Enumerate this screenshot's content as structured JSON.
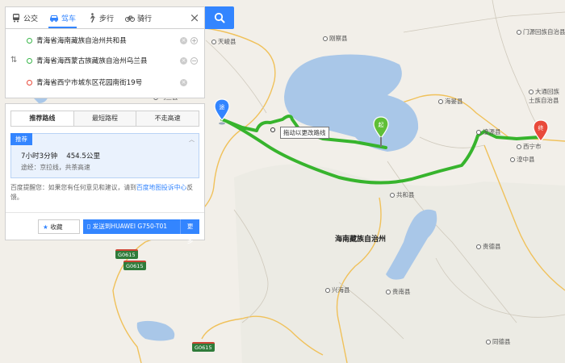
{
  "tabs": [
    {
      "label": "公交",
      "icon": "bus-icon"
    },
    {
      "label": "驾车",
      "icon": "car-icon",
      "active": true
    },
    {
      "label": "步行",
      "icon": "walk-icon"
    },
    {
      "label": "骑行",
      "icon": "bike-icon"
    }
  ],
  "close_label": "×",
  "inputs": [
    {
      "value": "青海省海南藏族自治州共和县",
      "role": "start"
    },
    {
      "value": "青海省海西蒙古族藏族自治州乌兰县",
      "role": "via"
    },
    {
      "value": "青海省西宁市城东区花园南街19号",
      "role": "end"
    }
  ],
  "swap_label": "⇅",
  "route_tabs": [
    "推荐路线",
    "最短路程",
    "不走高速"
  ],
  "plan": {
    "badge": "推荐",
    "time": "7小时3分钟",
    "distance": "454.5公里",
    "via": "途经：京拉线，共茶高速"
  },
  "tip": {
    "before": "百度提醒您：如果您有任何意见和建议，请到",
    "link": "百度地图投诉中心",
    "after": "反馈。"
  },
  "actions": {
    "favorite": "收藏",
    "send": "发送到HUAWEI G750-T01",
    "more": "更多"
  },
  "map": {
    "drag_tip": "拖动以更改路线",
    "markers": {
      "start": "起",
      "end": "终",
      "via": "途"
    },
    "labels": [
      "门源回族自治县",
      "刚察县",
      "天峻县",
      "海晏县",
      "湟源县",
      "湟中县",
      "大通回族土族自治县",
      "乌兰县",
      "共和县",
      "海南藏族自治州",
      "贵德县",
      "兴海县",
      "贵南县",
      "同德县",
      "西宁市"
    ],
    "shields": [
      "G0615",
      "G0615",
      "G0615"
    ],
    "colors": {
      "route": "#37b42d",
      "lake": "#a9c7e8",
      "accent": "#3385ff"
    }
  }
}
